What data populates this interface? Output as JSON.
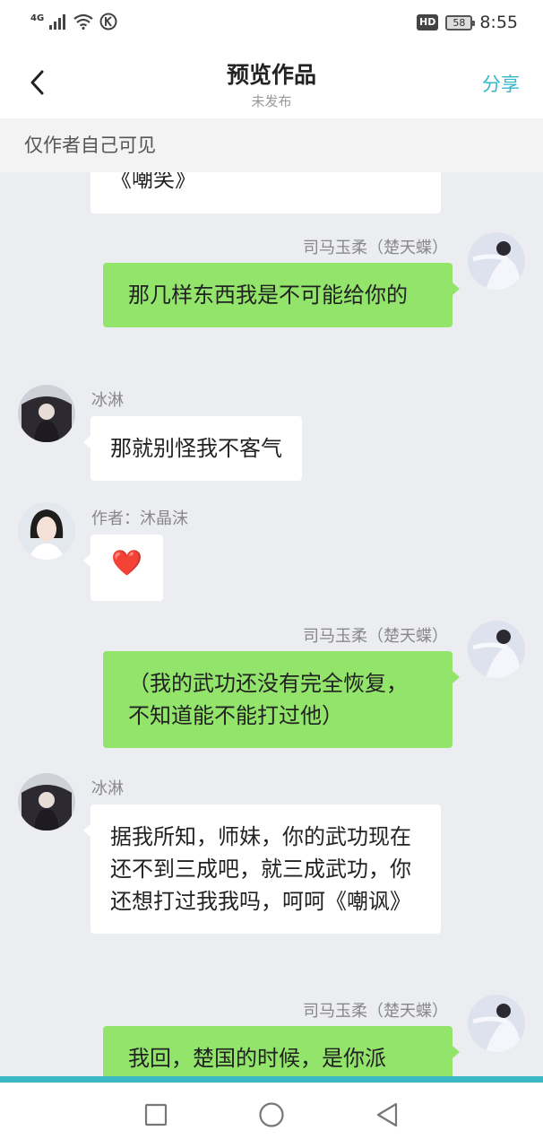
{
  "status_bar": {
    "network": "4G",
    "battery": "58",
    "hd": "HD",
    "time": "8:55"
  },
  "header": {
    "title": "预览作品",
    "subtitle": "未发布",
    "share_label": "分享",
    "back_icon": "chevron-left-icon"
  },
  "notice": "仅作者自己可见",
  "messages": [
    {
      "side": "left",
      "name": "",
      "text": "《嘲笑》"
    },
    {
      "side": "right",
      "name": "司马玉柔（楚天蝶）",
      "text": "那几样东西我是不可能给你的"
    },
    {
      "side": "left",
      "name": "冰淋",
      "text": "那就别怪我不客气"
    },
    {
      "side": "left",
      "name": "作者：沐晶沫",
      "text": "❤️"
    },
    {
      "side": "right",
      "name": "司马玉柔（楚天蝶）",
      "text": "（我的武功还没有完全恢复，不知道能不能打过他）"
    },
    {
      "side": "left",
      "name": "冰淋",
      "text": "据我所知，师妹，你的武功现在还不到三成吧，就三成武功，你还想打过我我吗，呵呵《嘲讽》"
    },
    {
      "side": "right",
      "name": "司马玉柔（楚天蝶）",
      "text": "我回，楚国的时候，是你派"
    }
  ],
  "colors": {
    "accent": "#34b7c7",
    "bubble_right": "#92e56a",
    "bubble_left": "#ffffff",
    "chat_bg": "#ecedf1"
  },
  "nav": {
    "icons": [
      "square-icon",
      "circle-icon",
      "triangle-back-icon"
    ]
  }
}
